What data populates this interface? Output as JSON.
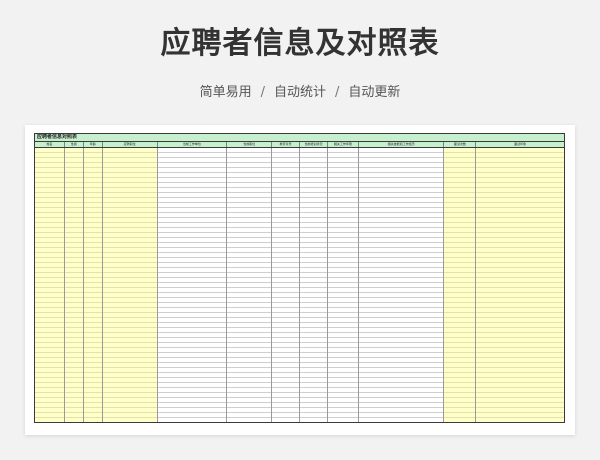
{
  "page": {
    "title": "应聘者信息及对照表",
    "tagline": [
      "简单易用",
      "自动统计",
      "自动更新"
    ],
    "tagline_separator": "/"
  },
  "sheet": {
    "caption": "应聘者信息对照表",
    "header_color": "#c6efce",
    "highlight_color": "#ffffcc",
    "columns": [
      {
        "label": "姓名",
        "highlight": true
      },
      {
        "label": "性别",
        "highlight": true
      },
      {
        "label": "年龄",
        "highlight": true
      },
      {
        "label": "应聘职位",
        "highlight": true
      },
      {
        "label": "当前工作单位",
        "highlight": false
      },
      {
        "label": "当前职位",
        "highlight": false
      },
      {
        "label": "教育背景",
        "highlight": false
      },
      {
        "label": "当前培训状况",
        "highlight": false
      },
      {
        "label": "相关工作年限",
        "highlight": false
      },
      {
        "label": "相关技能和工作经历",
        "highlight": false
      },
      {
        "label": "面试次数",
        "highlight": true
      },
      {
        "label": "面试印象",
        "highlight": true
      }
    ]
  }
}
